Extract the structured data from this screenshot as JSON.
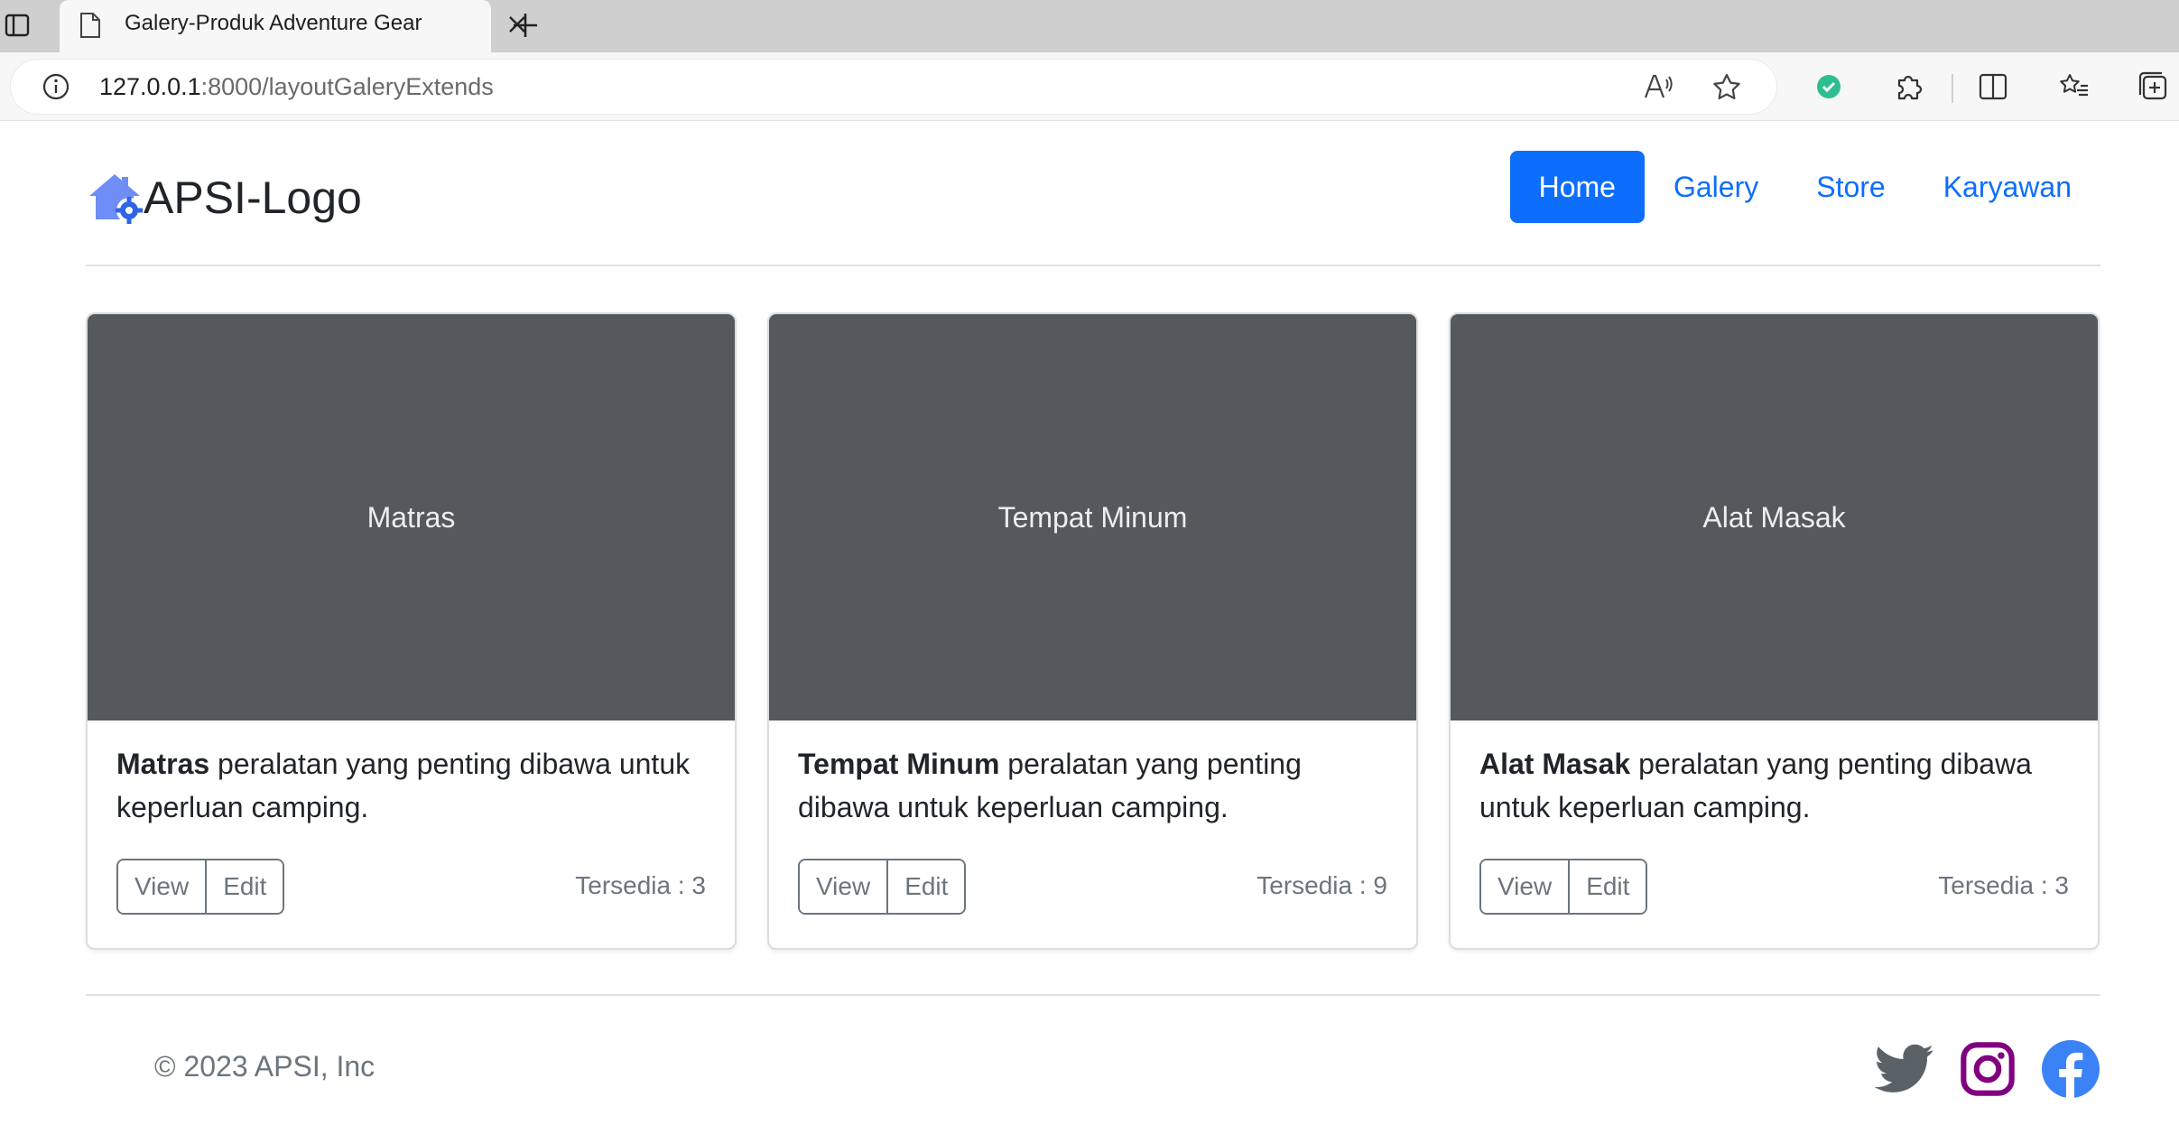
{
  "browser": {
    "tab_title": "Galery-Produk Adventure Gear",
    "url_host": "127.0.0.1",
    "url_path": ":8000/layoutGaleryExtends"
  },
  "navbar": {
    "brand": "APSI-Logo",
    "links": [
      {
        "label": "Home",
        "active": true
      },
      {
        "label": "Galery",
        "active": false
      },
      {
        "label": "Store",
        "active": false
      },
      {
        "label": "Karyawan",
        "active": false
      }
    ]
  },
  "products": [
    {
      "image_label": "Matras",
      "name": "Matras",
      "description": " peralatan yang penting dibawa untuk keperluan camping.",
      "view_label": "View",
      "edit_label": "Edit",
      "stock": "Tersedia : 3"
    },
    {
      "image_label": "Tempat Minum",
      "name": "Tempat Minum",
      "description": " peralatan yang penting dibawa untuk keperluan camping.",
      "view_label": "View",
      "edit_label": "Edit",
      "stock": "Tersedia : 9"
    },
    {
      "image_label": "Alat Masak",
      "name": "Alat Masak",
      "description": " peralatan yang penting dibawa untuk keperluan camping.",
      "view_label": "View",
      "edit_label": "Edit",
      "stock": "Tersedia : 3"
    }
  ],
  "footer": {
    "copyright": "© 2023 APSI, Inc",
    "socials": [
      "twitter-icon",
      "instagram-icon",
      "facebook-icon"
    ]
  },
  "colors": {
    "primary": "#0d6efd",
    "card_image_bg": "#55595c",
    "twitter": "#5a6268",
    "instagram": "#800080",
    "facebook": "#3b82f6"
  }
}
